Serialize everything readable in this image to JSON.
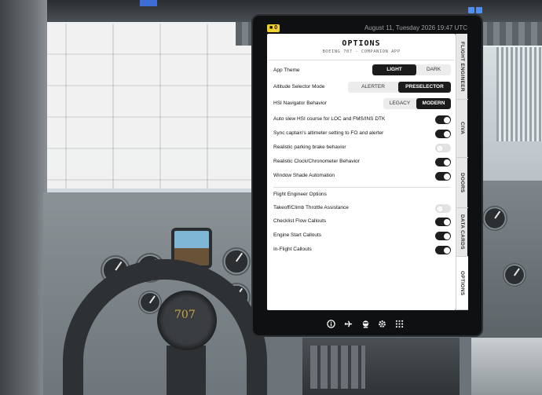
{
  "status": {
    "alert_count": "0",
    "date": "August 11, Tuesday 2026 19:47 UTC"
  },
  "header": {
    "title": "OPTIONS",
    "subtitle": "BOEING 707 - COMPANION APP"
  },
  "options": {
    "app_theme": {
      "label": "App Theme",
      "choices": [
        "LIGHT",
        "DARK"
      ],
      "selected": "LIGHT"
    },
    "altitude_selector_mode": {
      "label": "Altitude Selector Mode",
      "choices": [
        "ALERTER",
        "PRESELECTOR"
      ],
      "selected": "PRESELECTOR"
    },
    "hsi_navigator_behavior": {
      "label": "HSI Navigator Behavior",
      "choices": [
        "LEGACY",
        "MODERN"
      ],
      "selected": "MODERN"
    },
    "toggles": [
      {
        "label": "Auto slew HSI course for LOC and FMS/INS DTK",
        "on": true
      },
      {
        "label": "Sync captain's altimeter setting to FO and alerter",
        "on": true
      },
      {
        "label": "Realistic parking brake behavior",
        "on": false
      },
      {
        "label": "Realistic Clock/Chronometer Behavior",
        "on": true
      },
      {
        "label": "Window Shade Automation",
        "on": true
      }
    ]
  },
  "flight_engineer": {
    "section_title": "Flight Engineer Options",
    "toggles": [
      {
        "label": "Takeoff/Climb Throttle Assistance",
        "on": false
      },
      {
        "label": "Checklist Flow Callouts",
        "on": true
      },
      {
        "label": "Engine Start Callouts",
        "on": true
      },
      {
        "label": "In-Flight Callouts",
        "on": true
      }
    ]
  },
  "side_tabs": [
    "FLIGHT ENGINEER",
    "CIVA",
    "DOORS",
    "DATA CARDS",
    "OPTIONS"
  ],
  "active_tab": "OPTIONS",
  "bottom_nav": [
    "info-icon",
    "plane-icon",
    "pilot-icon",
    "gear-icon",
    "grid-icon"
  ],
  "background": {
    "yoke_badge": "707"
  },
  "colors": {
    "toggle_on": "#1e1e1e",
    "toggle_off": "#e3e3e3",
    "alert_badge": "#f2d02c",
    "window_control": "#4e8ff0"
  }
}
